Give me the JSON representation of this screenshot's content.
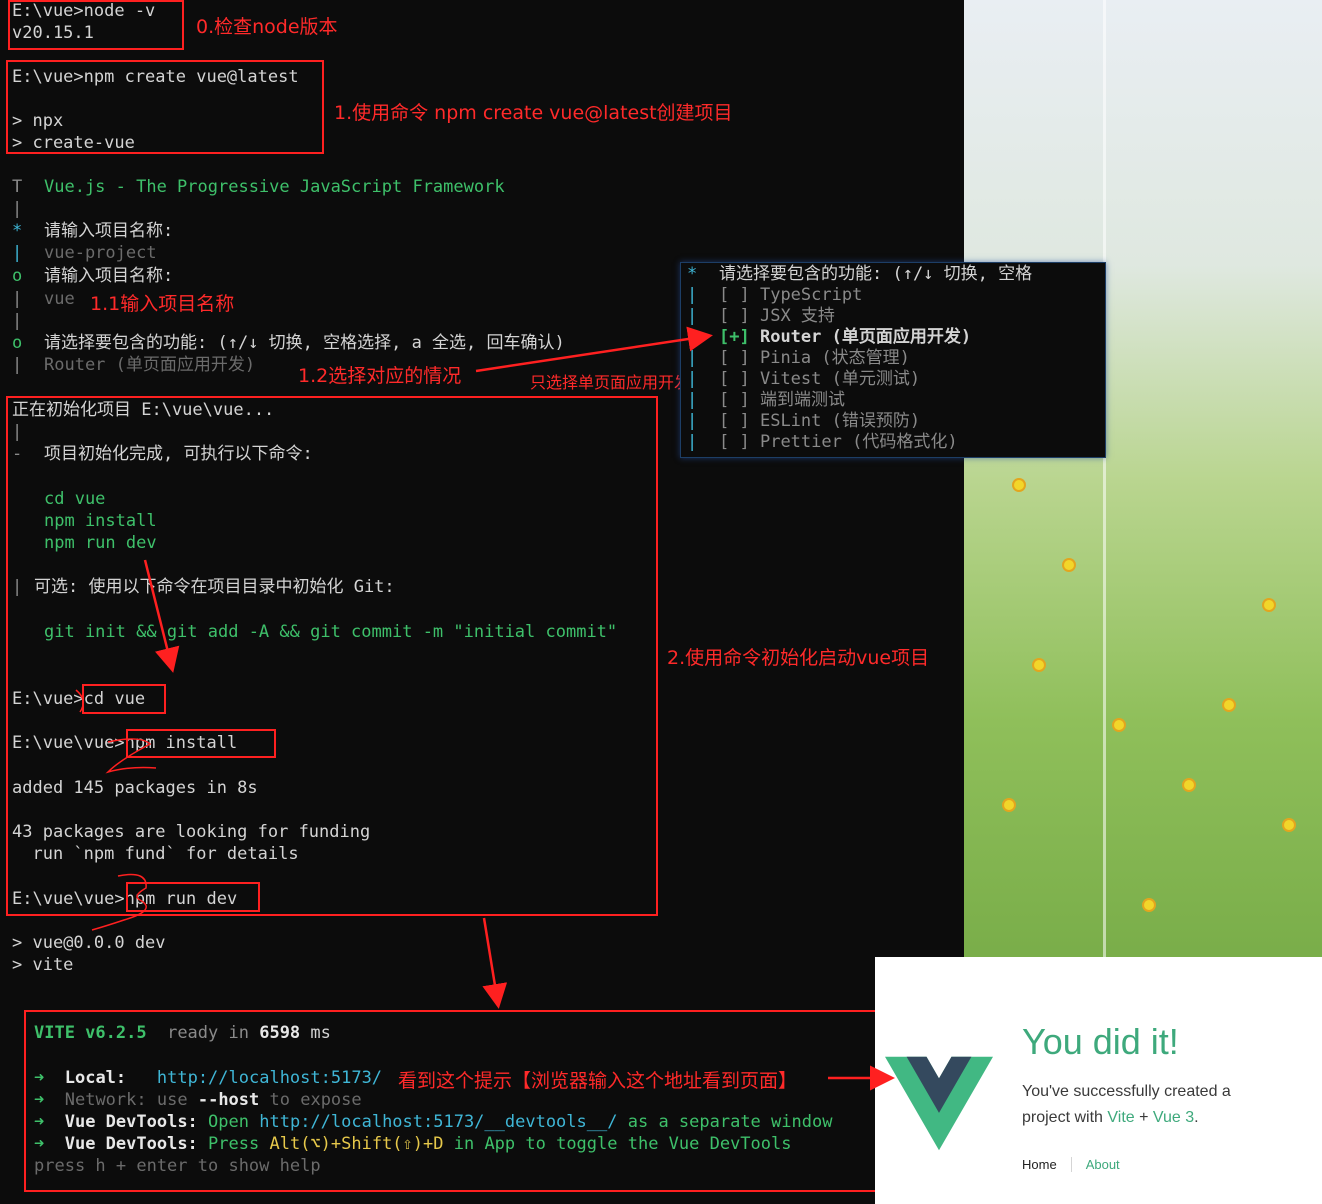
{
  "terminal": {
    "cmd_node": "E:\\vue>node -v",
    "node_version": "v20.15.1",
    "cmd_create": "E:\\vue>npm create vue@latest",
    "npx_line": "> npx",
    "create_vue_line": "> create-vue",
    "banner_t": "T",
    "banner": "Vue.js - The Progressive JavaScript Framework",
    "prompt_name_label": "请输入项目名称:",
    "prompt_name_placeholder": "vue-project",
    "prompt_name_label_done": "请输入项目名称:",
    "prompt_name_value": "vue",
    "prompt_features_label": "请选择要包含的功能: (↑/↓ 切换, 空格选择, a 全选, 回车确认)",
    "prompt_features_value": "Router (单页面应用开发)",
    "init_line": "正在初始化项目 E:\\vue\\vue...",
    "init_done": "项目初始化完成, 可执行以下命令:",
    "next_cmds": [
      "cd vue",
      "npm install",
      "npm run dev"
    ],
    "git_hint": "可选: 使用以下命令在项目目录中初始化 Git:",
    "git_cmd": "git init && git add -A && git commit -m \"initial commit\"",
    "cmd_cd_prompt": "E:\\vue>",
    "cmd_cd": "cd vue",
    "cmd_install_prompt": "E:\\vue\\vue>",
    "cmd_install": "npm install",
    "added": "added 145 packages in 8s",
    "funding1": "43 packages are looking for funding",
    "funding2": "  run `npm fund` for details",
    "cmd_dev_prompt": "E:\\vue\\vue>",
    "cmd_dev": "npm run dev",
    "dev_line1": "> vue@0.0.0 dev",
    "dev_line2": "> vite"
  },
  "vite": {
    "name": "VITE v6.2.5",
    "ready": "ready in",
    "ms_value": "6598",
    "ms_unit": "ms",
    "local_label": "Local:",
    "local_url": "http://localhost:5173/",
    "network_label": "Network:",
    "network_text1": "use",
    "network_flag": "--host",
    "network_text2": "to expose",
    "devtools_label": "Vue DevTools:",
    "devtools_open": "Open",
    "devtools_url": "http://localhost:5173/__devtools__/",
    "devtools_sep": "as a separate window",
    "devtools_label2": "Vue DevTools:",
    "devtools_press": "Press",
    "devtools_keys": "Alt(⌥)+Shift(⇧)+D",
    "devtools_toggle": "in App to toggle the Vue DevTools",
    "help": "press h + enter to show help",
    "help_h": "h",
    "help_enter": "enter"
  },
  "popup": {
    "title": "请选择要包含的功能: (↑/↓ 切换, 空格",
    "items": [
      {
        "mark": "[ ]",
        "label": "TypeScript"
      },
      {
        "mark": "[ ]",
        "label": "JSX 支持"
      },
      {
        "mark": "[+]",
        "label": "Router (单页面应用开发)"
      },
      {
        "mark": "[ ]",
        "label": "Pinia (状态管理)"
      },
      {
        "mark": "[ ]",
        "label": "Vitest (单元测试)"
      },
      {
        "mark": "[ ]",
        "label": "端到端测试"
      },
      {
        "mark": "[ ]",
        "label": "ESLint (错误预防)"
      },
      {
        "mark": "[ ]",
        "label": "Prettier (代码格式化)"
      }
    ]
  },
  "annotations": {
    "a0": "0.检查node版本",
    "a1": "1.使用命令 npm create vue@latest创建项目",
    "a11": "1.1输入项目名称",
    "a12": "1.2选择对应的情况",
    "a12b": "只选择单页面应用开发",
    "a2": "2.使用命令初始化启动vue项目",
    "a3": "看到这个提示【浏览器输入这个地址看到页面】"
  },
  "vue_page": {
    "title": "You did it!",
    "sub1": "You've successfully created a",
    "sub2": "project with",
    "vite": "Vite",
    "plus": "+",
    "vue3": "Vue 3",
    "dot": ".",
    "nav_home": "Home",
    "nav_about": "About"
  },
  "colors": {
    "terminal_bg": "#0c0c0c",
    "annotation_red": "#ff2a2a",
    "vue_green": "#3ea97c",
    "vue_dark": "#34495e"
  }
}
